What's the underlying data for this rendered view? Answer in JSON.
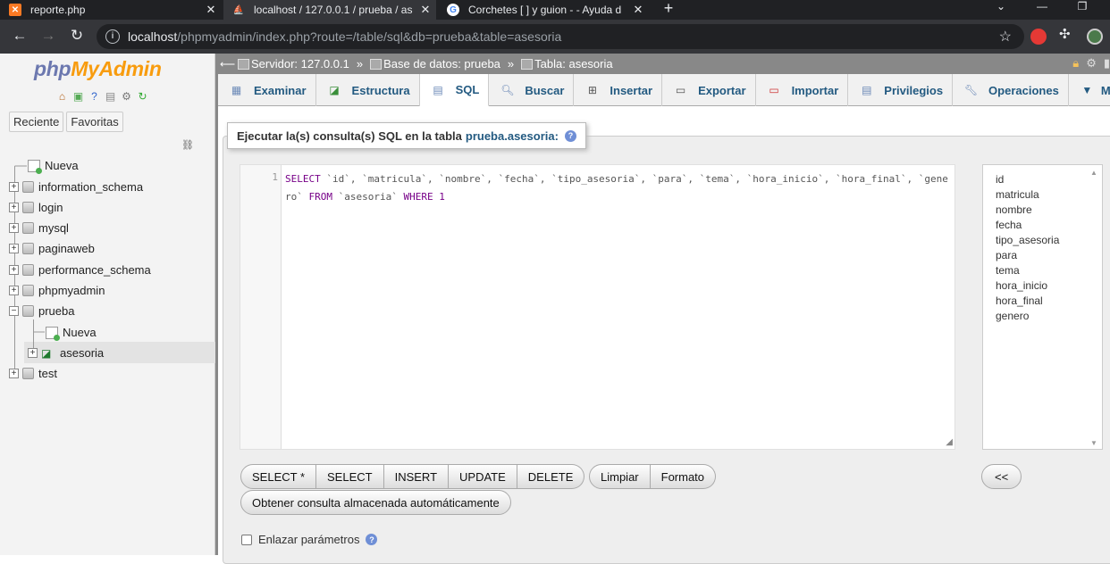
{
  "browser": {
    "tabs": [
      {
        "title": "reporte.php",
        "icon": "xampp-icon",
        "active": false
      },
      {
        "title": "localhost / 127.0.0.1 / prueba / as",
        "icon": "phpmyadmin-sail-icon",
        "active": true
      },
      {
        "title": "Corchetes [ ] y guion - - Ayuda d",
        "icon": "google-icon",
        "active": false
      }
    ],
    "url_host": "localhost",
    "url_path": "/phpmyadmin/index.php?route=/table/sql&db=prueba&table=asesoria"
  },
  "sidebar": {
    "logo_php": "php",
    "logo_admin": "MyAdmin",
    "tabs": [
      "Reciente",
      "Favoritas"
    ],
    "tree": [
      {
        "label": "Nueva",
        "type": "new",
        "level": 0
      },
      {
        "label": "information_schema",
        "type": "db",
        "level": 0
      },
      {
        "label": "login",
        "type": "db",
        "level": 0
      },
      {
        "label": "mysql",
        "type": "db",
        "level": 0
      },
      {
        "label": "paginaweb",
        "type": "db",
        "level": 0
      },
      {
        "label": "performance_schema",
        "type": "db",
        "level": 0
      },
      {
        "label": "phpmyadmin",
        "type": "db",
        "level": 0
      },
      {
        "label": "prueba",
        "type": "db",
        "level": 0,
        "expanded": true
      },
      {
        "label": "Nueva",
        "type": "new",
        "level": 1
      },
      {
        "label": "asesoria",
        "type": "table",
        "level": 1,
        "selected": true
      },
      {
        "label": "test",
        "type": "db",
        "level": 0
      }
    ]
  },
  "breadcrumb": {
    "server": "Servidor: 127.0.0.1",
    "database": "Base de datos: prueba",
    "table": "Tabla: asesoria",
    "separator": "»"
  },
  "menu": {
    "tabs": [
      {
        "label": "Examinar",
        "icon": "browse-icon"
      },
      {
        "label": "Estructura",
        "icon": "structure-icon"
      },
      {
        "label": "SQL",
        "icon": "sql-icon",
        "active": true
      },
      {
        "label": "Buscar",
        "icon": "search-icon"
      },
      {
        "label": "Insertar",
        "icon": "insert-icon"
      },
      {
        "label": "Exportar",
        "icon": "export-icon"
      },
      {
        "label": "Importar",
        "icon": "import-icon"
      },
      {
        "label": "Privilegios",
        "icon": "privileges-icon"
      },
      {
        "label": "Operaciones",
        "icon": "operations-icon"
      },
      {
        "label": "Más",
        "icon": "caret-down-icon"
      }
    ]
  },
  "sql_panel": {
    "legend_prefix": "Ejecutar la(s) consulta(s) SQL en la tabla",
    "legend_table": "prueba.asesoria:",
    "line_number": "1",
    "query": "SELECT `id`, `matricula`, `nombre`, `fecha`, `tipo_asesoria`, `para`, `tema`, `hora_inicio`, `hora_final`, `genero` FROM `asesoria` WHERE 1",
    "columns": [
      "id",
      "matricula",
      "nombre",
      "fecha",
      "tipo_asesoria",
      "para",
      "tema",
      "hora_inicio",
      "hora_final",
      "genero"
    ],
    "query_buttons": [
      "SELECT *",
      "SELECT",
      "INSERT",
      "UPDATE",
      "DELETE"
    ],
    "format_buttons": [
      "Limpiar",
      "Formato"
    ],
    "insert_column_button": "<<",
    "autosaved_button": "Obtener consulta almacenada automáticamente",
    "bind_params_label": "Enlazar parámetros"
  }
}
